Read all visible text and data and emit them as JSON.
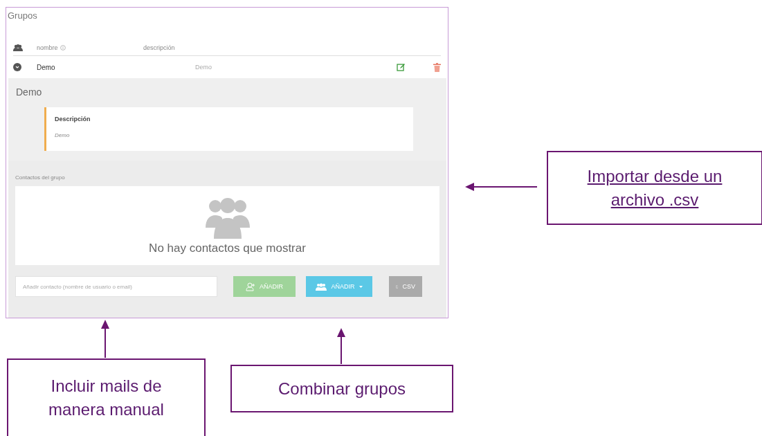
{
  "title": "Grupos",
  "table": {
    "columns": [
      {
        "label": "nombre",
        "info": true
      },
      {
        "label": "descripción",
        "info": false
      }
    ],
    "rows": [
      {
        "name": "Demo",
        "description": "Demo",
        "expanded": true
      }
    ]
  },
  "detail": {
    "title": "Demo",
    "description_label": "Descripción",
    "description": "Demo",
    "contacts_label": "Contactos del grupo",
    "empty_message": "No hay contactos que mostrar"
  },
  "add_field": {
    "placeholder": "Añadir contacto (nombre de usuario o email)"
  },
  "buttons": [
    {
      "kind": "add",
      "label": "AÑADIR"
    },
    {
      "kind": "add-group",
      "label": "AÑADIR"
    },
    {
      "kind": "csv",
      "label": "CSV"
    }
  ],
  "callouts": [
    {
      "kind": "link",
      "text": "Importar desde un archivo .csv"
    },
    {
      "kind": "note",
      "text": "Incluir mails de manera manual"
    },
    {
      "kind": "note",
      "text": "Combinar grupos"
    }
  ]
}
